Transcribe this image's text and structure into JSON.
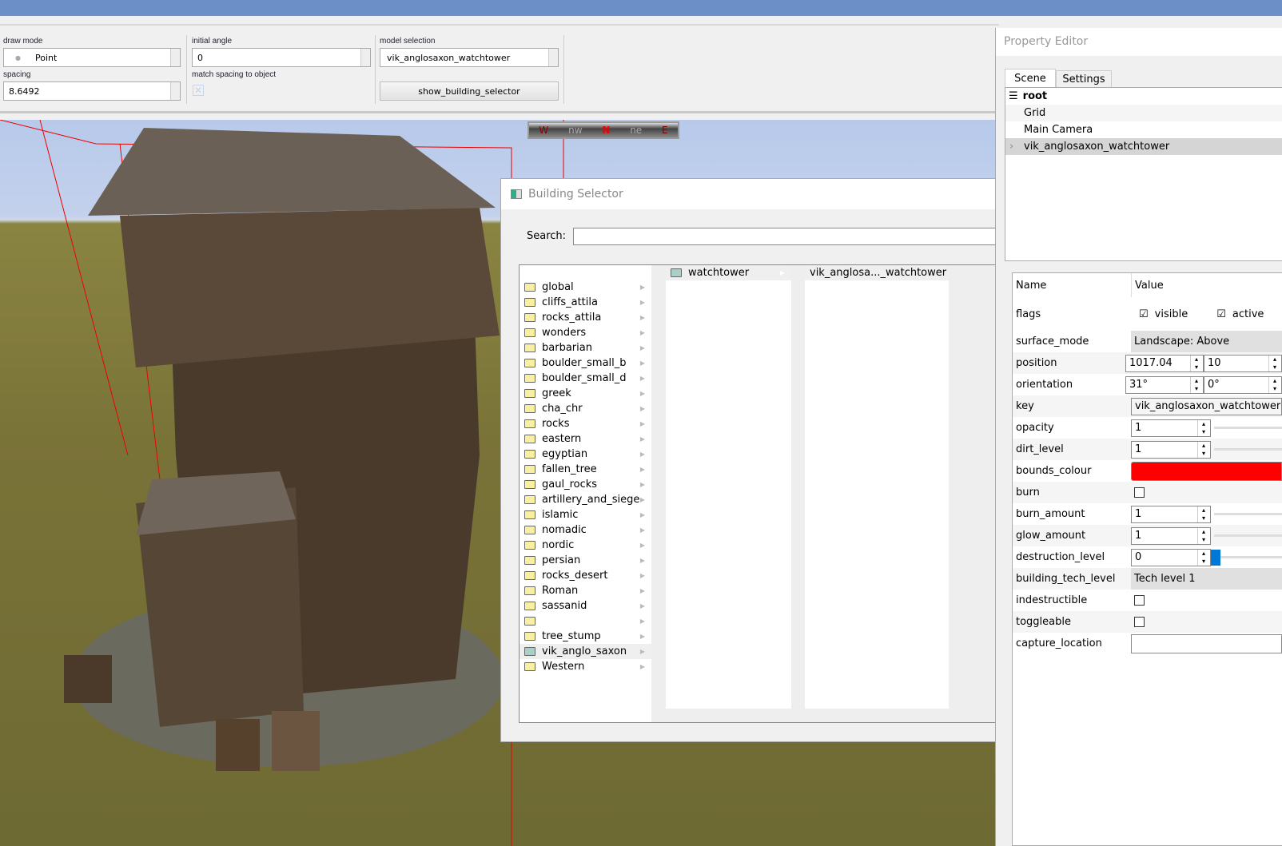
{
  "toolbar": {
    "draw_mode_label": "draw mode",
    "draw_mode_value": "Point",
    "initial_angle_label": "initial angle",
    "initial_angle_value": "0",
    "model_selection_label": "model selection",
    "model_selection_value": "vik_anglosaxon_watchtower",
    "spacing_label": "spacing",
    "spacing_value": "8.6492",
    "match_spacing_label": "match spacing to object",
    "match_spacing_checked": false,
    "show_building_selector": "show_building_selector"
  },
  "compass": {
    "labels": [
      "W",
      "nw",
      "N",
      "ne",
      "E"
    ]
  },
  "building_selector": {
    "title": "Building Selector",
    "search_label": "Search:",
    "search_value": "",
    "categories": [
      "global",
      "cliffs_attila",
      "rocks_attila",
      "wonders",
      "barbarian",
      "boulder_small_b",
      "boulder_small_d",
      "greek",
      "cha_chr",
      "rocks",
      "eastern",
      "egyptian",
      "fallen_tree",
      "gaul_rocks",
      "artillery_and_siege",
      "islamic",
      "nomadic",
      "nordic",
      "persian",
      "rocks_desert",
      "Roman",
      "sassanid",
      "",
      "tree_stump",
      "vik_anglo_saxon",
      "Western"
    ],
    "selected_category": "vik_anglo_saxon",
    "subcategory": "watchtower",
    "model": "vik_anglosa..._watchtower"
  },
  "property_editor": {
    "title": "Property Editor",
    "tabs": [
      "Scene",
      "Settings"
    ],
    "tree": {
      "root": "root",
      "items": [
        "Grid",
        "Main Camera",
        "vik_anglosaxon_watchtower"
      ]
    },
    "header": {
      "name": "Name",
      "value": "Value"
    },
    "flags": {
      "label": "flags",
      "visible": "visible",
      "active": "active"
    },
    "surface_mode": {
      "label": "surface_mode",
      "value": "Landscape: Above"
    },
    "position": {
      "label": "position",
      "x": "1017.04",
      "y": "10"
    },
    "orientation": {
      "label": "orientation",
      "x": "31°",
      "y": "0°"
    },
    "key": {
      "label": "key",
      "value": "vik_anglosaxon_watchtower"
    },
    "opacity": {
      "label": "opacity",
      "value": "1"
    },
    "dirt_level": {
      "label": "dirt_level",
      "value": "1"
    },
    "bounds_colour": {
      "label": "bounds_colour",
      "color": "#ff0000"
    },
    "burn": {
      "label": "burn"
    },
    "burn_amount": {
      "label": "burn_amount",
      "value": "1"
    },
    "glow_amount": {
      "label": "glow_amount",
      "value": "1"
    },
    "destruction_level": {
      "label": "destruction_level",
      "value": "0"
    },
    "building_tech_level": {
      "label": "building_tech_level",
      "value": "Tech level 1"
    },
    "indestructible": {
      "label": "indestructible"
    },
    "toggleable": {
      "label": "toggleable"
    },
    "capture_location": {
      "label": "capture_location",
      "value": ""
    }
  }
}
